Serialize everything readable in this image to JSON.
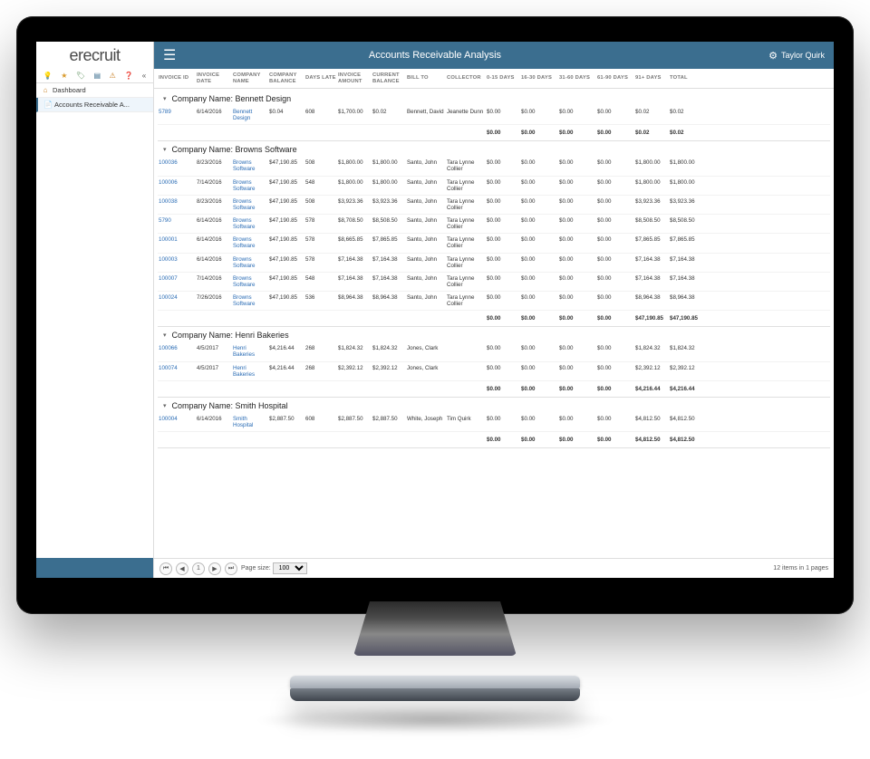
{
  "logo": "erecruit",
  "header": {
    "title": "Accounts Receivable Analysis",
    "user": "Taylor Quirk"
  },
  "nav": {
    "dashboard": "Dashboard",
    "ar": "Accounts Receivable A..."
  },
  "columns": [
    "INVOICE ID",
    "INVOICE DATE",
    "COMPANY NAME",
    "COMPANY BALANCE",
    "DAYS LATE",
    "INVOICE AMOUNT",
    "CURRENT BALANCE",
    "BILL TO",
    "COLLECTOR",
    "0-15 DAYS",
    "16-30 DAYS",
    "31-60 DAYS",
    "61-90 DAYS",
    "91+ DAYS",
    "TOTAL",
    ""
  ],
  "groups": [
    {
      "title": "Company Name: Bennett Design",
      "rows": [
        {
          "id": "5789",
          "date": "6/14/2016",
          "company": "Bennett Design",
          "cbal": "$0.04",
          "days": "608",
          "invamt": "$1,700.00",
          "curbal": "$0.02",
          "billto": "Bennett, David",
          "collector": "Jeanette Dunn",
          "d0": "$0.00",
          "d16": "$0.00",
          "d31": "$0.00",
          "d61": "$0.00",
          "d91": "$0.02",
          "total": "$0.02"
        }
      ],
      "subtotal": {
        "d0": "$0.00",
        "d16": "$0.00",
        "d31": "$0.00",
        "d61": "$0.00",
        "d91": "$0.02",
        "total": "$0.02"
      }
    },
    {
      "title": "Company Name: Browns Software",
      "rows": [
        {
          "id": "100036",
          "date": "8/23/2016",
          "company": "Browns Software",
          "cbal": "$47,190.85",
          "days": "508",
          "invamt": "$1,800.00",
          "curbal": "$1,800.00",
          "billto": "Santo, John",
          "collector": "Tara Lynne Collier",
          "d0": "$0.00",
          "d16": "$0.00",
          "d31": "$0.00",
          "d61": "$0.00",
          "d91": "$1,800.00",
          "total": "$1,800.00"
        },
        {
          "id": "100006",
          "date": "7/14/2016",
          "company": "Browns Software",
          "cbal": "$47,190.85",
          "days": "548",
          "invamt": "$1,800.00",
          "curbal": "$1,800.00",
          "billto": "Santo, John",
          "collector": "Tara Lynne Collier",
          "d0": "$0.00",
          "d16": "$0.00",
          "d31": "$0.00",
          "d61": "$0.00",
          "d91": "$1,800.00",
          "total": "$1,800.00"
        },
        {
          "id": "100038",
          "date": "8/23/2016",
          "company": "Browns Software",
          "cbal": "$47,190.85",
          "days": "508",
          "invamt": "$3,923.36",
          "curbal": "$3,923.36",
          "billto": "Santo, John",
          "collector": "Tara Lynne Collier",
          "d0": "$0.00",
          "d16": "$0.00",
          "d31": "$0.00",
          "d61": "$0.00",
          "d91": "$3,923.36",
          "total": "$3,923.36"
        },
        {
          "id": "5790",
          "date": "6/14/2016",
          "company": "Browns Software",
          "cbal": "$47,190.85",
          "days": "578",
          "invamt": "$8,708.50",
          "curbal": "$8,508.50",
          "billto": "Santo, John",
          "collector": "Tara Lynne Collier",
          "d0": "$0.00",
          "d16": "$0.00",
          "d31": "$0.00",
          "d61": "$0.00",
          "d91": "$8,508.50",
          "total": "$8,508.50"
        },
        {
          "id": "100001",
          "date": "6/14/2016",
          "company": "Browns Software",
          "cbal": "$47,190.85",
          "days": "578",
          "invamt": "$8,665.85",
          "curbal": "$7,865.85",
          "billto": "Santo, John",
          "collector": "Tara Lynne Collier",
          "d0": "$0.00",
          "d16": "$0.00",
          "d31": "$0.00",
          "d61": "$0.00",
          "d91": "$7,865.85",
          "total": "$7,865.85"
        },
        {
          "id": "100003",
          "date": "6/14/2016",
          "company": "Browns Software",
          "cbal": "$47,190.85",
          "days": "578",
          "invamt": "$7,164.38",
          "curbal": "$7,164.38",
          "billto": "Santo, John",
          "collector": "Tara Lynne Collier",
          "d0": "$0.00",
          "d16": "$0.00",
          "d31": "$0.00",
          "d61": "$0.00",
          "d91": "$7,164.38",
          "total": "$7,164.38"
        },
        {
          "id": "100007",
          "date": "7/14/2016",
          "company": "Browns Software",
          "cbal": "$47,190.85",
          "days": "548",
          "invamt": "$7,164.38",
          "curbal": "$7,164.38",
          "billto": "Santo, John",
          "collector": "Tara Lynne Collier",
          "d0": "$0.00",
          "d16": "$0.00",
          "d31": "$0.00",
          "d61": "$0.00",
          "d91": "$7,164.38",
          "total": "$7,164.38"
        },
        {
          "id": "100024",
          "date": "7/26/2016",
          "company": "Browns Software",
          "cbal": "$47,190.85",
          "days": "536",
          "invamt": "$8,964.38",
          "curbal": "$8,964.38",
          "billto": "Santo, John",
          "collector": "Tara Lynne Collier",
          "d0": "$0.00",
          "d16": "$0.00",
          "d31": "$0.00",
          "d61": "$0.00",
          "d91": "$8,964.38",
          "total": "$8,964.38"
        }
      ],
      "subtotal": {
        "d0": "$0.00",
        "d16": "$0.00",
        "d31": "$0.00",
        "d61": "$0.00",
        "d91": "$47,190.85",
        "total": "$47,190.85"
      }
    },
    {
      "title": "Company Name: Henri Bakeries",
      "rows": [
        {
          "id": "100066",
          "date": "4/5/2017",
          "company": "Henri Bakeries",
          "cbal": "$4,216.44",
          "days": "268",
          "invamt": "$1,824.32",
          "curbal": "$1,824.32",
          "billto": "Jones, Clark",
          "collector": "",
          "d0": "$0.00",
          "d16": "$0.00",
          "d31": "$0.00",
          "d61": "$0.00",
          "d91": "$1,824.32",
          "total": "$1,824.32"
        },
        {
          "id": "100074",
          "date": "4/5/2017",
          "company": "Henri Bakeries",
          "cbal": "$4,216.44",
          "days": "268",
          "invamt": "$2,392.12",
          "curbal": "$2,392.12",
          "billto": "Jones, Clark",
          "collector": "",
          "d0": "$0.00",
          "d16": "$0.00",
          "d31": "$0.00",
          "d61": "$0.00",
          "d91": "$2,392.12",
          "total": "$2,392.12"
        }
      ],
      "subtotal": {
        "d0": "$0.00",
        "d16": "$0.00",
        "d31": "$0.00",
        "d61": "$0.00",
        "d91": "$4,216.44",
        "total": "$4,216.44"
      }
    },
    {
      "title": "Company Name: Smith Hospital",
      "rows": [
        {
          "id": "100004",
          "date": "6/14/2016",
          "company": "Smith Hospital",
          "cbal": "$2,887.50",
          "days": "608",
          "invamt": "$2,887.50",
          "curbal": "$2,887.50",
          "billto": "White, Joseph",
          "collector": "Tim Quirk",
          "d0": "$0.00",
          "d16": "$0.00",
          "d31": "$0.00",
          "d61": "$0.00",
          "d91": "$4,812.50",
          "total": "$4,812.50"
        }
      ],
      "subtotal": {
        "d0": "$0.00",
        "d16": "$0.00",
        "d31": "$0.00",
        "d61": "$0.00",
        "d91": "$4,812.50",
        "total": "$4,812.50"
      }
    }
  ],
  "pager": {
    "page": "1",
    "pageSizeLabel": "Page size:",
    "pageSize": "100",
    "summary": "12 items in 1 pages"
  }
}
